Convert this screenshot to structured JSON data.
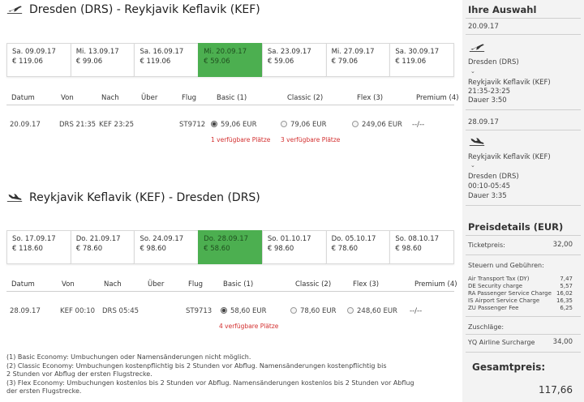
{
  "outbound": {
    "title": "Dresden (DRS) - Reykjavik Keflavik (KEF)",
    "dates": [
      {
        "date": "Sa. 09.09.17",
        "price": "€ 119.06",
        "selected": false
      },
      {
        "date": "Mi. 13.09.17",
        "price": "€ 99.06",
        "selected": false
      },
      {
        "date": "Sa. 16.09.17",
        "price": "€ 119.06",
        "selected": false
      },
      {
        "date": "Mi. 20.09.17",
        "price": "€ 59.06",
        "selected": true
      },
      {
        "date": "Sa. 23.09.17",
        "price": "€ 59.06",
        "selected": false
      },
      {
        "date": "Mi. 27.09.17",
        "price": "€ 79.06",
        "selected": false
      },
      {
        "date": "Sa. 30.09.17",
        "price": "€ 119.06",
        "selected": false
      }
    ],
    "headers": {
      "datum": "Datum",
      "von": "Von",
      "nach": "Nach",
      "ueber": "Über",
      "flug": "Flug",
      "basic": "Basic (1)",
      "classic": "Classic (2)",
      "flex": "Flex (3)",
      "premium": "Premium (4)"
    },
    "row": {
      "datum": "20.09.17",
      "von": "DRS 21:35",
      "nach": "KEF 23:25",
      "flug": "ST9712",
      "basic": "59,06 EUR",
      "classic": "79,06 EUR",
      "flex": "249,06 EUR",
      "premium": "--/--"
    },
    "avail_basic": "1 verfügbare Plätze",
    "avail_classic": "3 verfügbare Plätze"
  },
  "inbound": {
    "title": "Reykjavik Keflavik (KEF) - Dresden (DRS)",
    "dates": [
      {
        "date": "So. 17.09.17",
        "price": "€ 118.60",
        "selected": false
      },
      {
        "date": "Do. 21.09.17",
        "price": "€ 78.60",
        "selected": false
      },
      {
        "date": "So. 24.09.17",
        "price": "€ 98.60",
        "selected": false
      },
      {
        "date": "Do. 28.09.17",
        "price": "€ 58.60",
        "selected": true
      },
      {
        "date": "So. 01.10.17",
        "price": "€ 98.60",
        "selected": false
      },
      {
        "date": "Do. 05.10.17",
        "price": "€ 78.60",
        "selected": false
      },
      {
        "date": "So. 08.10.17",
        "price": "€ 98.60",
        "selected": false
      }
    ],
    "headers": {
      "datum": "Datum",
      "von": "Von",
      "nach": "Nach",
      "ueber": "Über",
      "flug": "Flug",
      "basic": "Basic (1)",
      "classic": "Classic (2)",
      "flex": "Flex (3)",
      "premium": "Premium (4)"
    },
    "row": {
      "datum": "28.09.17",
      "von": "KEF 00:10",
      "nach": "DRS 05:45",
      "flug": "ST9713",
      "basic": "58,60 EUR",
      "classic": "78,60 EUR",
      "flex": "248,60 EUR",
      "premium": "--/--"
    },
    "avail_basic": "4 verfügbare Plätze"
  },
  "footnotes": [
    "(1) Basic Economy: Umbuchungen oder Namensänderungen nicht möglich.",
    "(2) Classic Economy: Umbuchungen kostenpflichtig bis 2 Stunden vor Abflug. Namensänderungen kostenpflichtig bis",
    "2 Stunden vor Abflug der ersten Flugstrecke.",
    "(3) Flex Economy: Umbuchungen kostenlos bis 2 Stunden vor Abflug. Namensänderungen kostenlos bis 2 Stunden vor Abflug",
    "der ersten Flugstrecke."
  ],
  "sidebar": {
    "title": "Ihre Auswahl",
    "out": {
      "date": "20.09.17",
      "from": "Dresden (DRS)",
      "to": "Reykjavik Keflavik (KEF)",
      "time": "21:35-23:25",
      "duration": "Dauer  3:50"
    },
    "ret": {
      "date": "28.09.17",
      "from": "Reykjavik Keflavik (KEF)",
      "to": "Dresden (DRS)",
      "time": "00:10-05:45",
      "duration": "Dauer  3:35"
    },
    "price_title": "Preisdetails (EUR)",
    "ticket_label": "Ticketpreis:",
    "ticket_value": "32,00",
    "taxes_label": "Steuern und Gebühren:",
    "taxes": [
      {
        "name": "Air Transport Tax (DY)",
        "value": "7,47"
      },
      {
        "name": "DE Security charge",
        "value": "5,57"
      },
      {
        "name": "RA Passenger Service Charge",
        "value": "16,02"
      },
      {
        "name": "IS Airport Service Charge",
        "value": "16,35"
      },
      {
        "name": "ZU Passenger Fee",
        "value": "6,25"
      }
    ],
    "surcharge_label": "Zuschläge:",
    "surcharge_name": "YQ Airline Surcharge",
    "surcharge_value": "34,00",
    "total_label": "Gesamtpreis:",
    "total_value": "117,66"
  },
  "colors": {
    "selected": "#4caf50",
    "availability": "#d32f2f",
    "sidebar_bg": "#f3f3f3"
  }
}
